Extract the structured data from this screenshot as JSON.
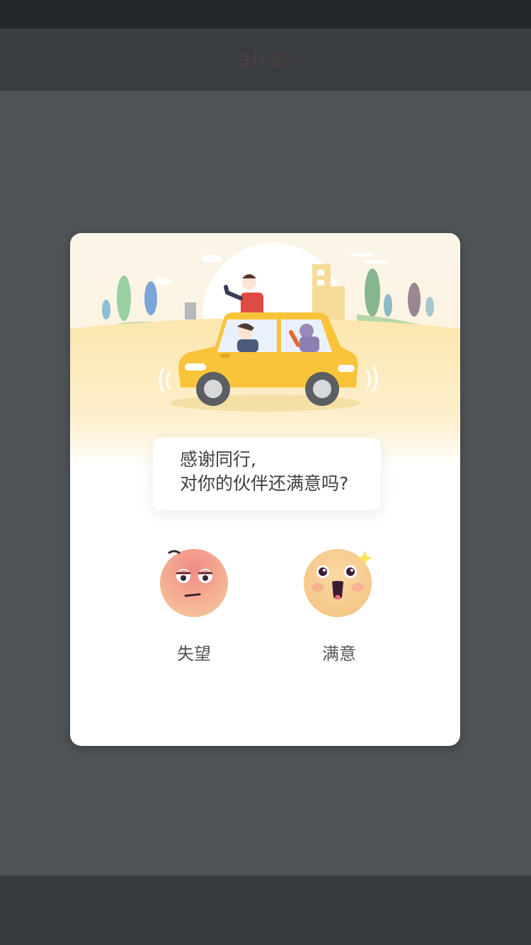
{
  "nav": {
    "title": "alias"
  },
  "dialog": {
    "message_line1": "感谢同行,",
    "message_line2": "对你的伙伴还满意吗?",
    "options": [
      {
        "label": "失望",
        "icon": "disappointed-face-icon"
      },
      {
        "label": "满意",
        "icon": "satisfied-face-icon"
      }
    ]
  },
  "colors": {
    "overlay": "#4f5357",
    "card": "#ffffff",
    "car": "#f9c43a",
    "ground": "#fce8b0"
  }
}
